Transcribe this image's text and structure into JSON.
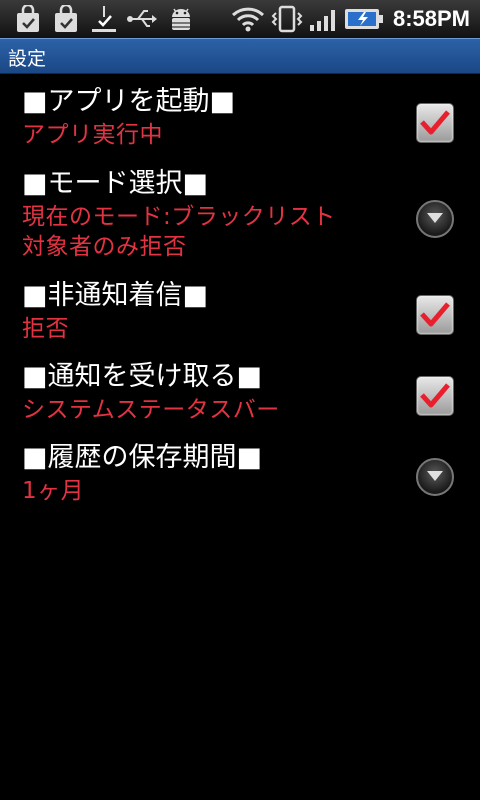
{
  "status_bar": {
    "time": "8:58PM",
    "icons": [
      "shopping-bag-icon",
      "shopping-bag-icon",
      "download-done-icon",
      "usb-icon",
      "android-debug-icon",
      "wifi-icon",
      "vibrate-icon",
      "signal-icon",
      "battery-charging-icon"
    ]
  },
  "title_bar": {
    "title": "設定"
  },
  "preferences": [
    {
      "title": "■アプリを起動■",
      "summary": "アプリ実行中",
      "widget": "checkbox",
      "checked": true
    },
    {
      "title": "■モード選択■",
      "summary": "現在のモード:ブラックリスト\n対象者のみ拒否",
      "widget": "dropdown"
    },
    {
      "title": "■非通知着信■",
      "summary": "拒否",
      "widget": "checkbox",
      "checked": true
    },
    {
      "title": "■通知を受け取る■",
      "summary": "システムステータスバー",
      "widget": "checkbox",
      "checked": true
    },
    {
      "title": "■履歴の保存期間■",
      "summary": "1ヶ月",
      "widget": "dropdown"
    }
  ],
  "colors": {
    "summary": "#e33343",
    "check": "#e8202e",
    "title_bar": "#2d62a8"
  }
}
